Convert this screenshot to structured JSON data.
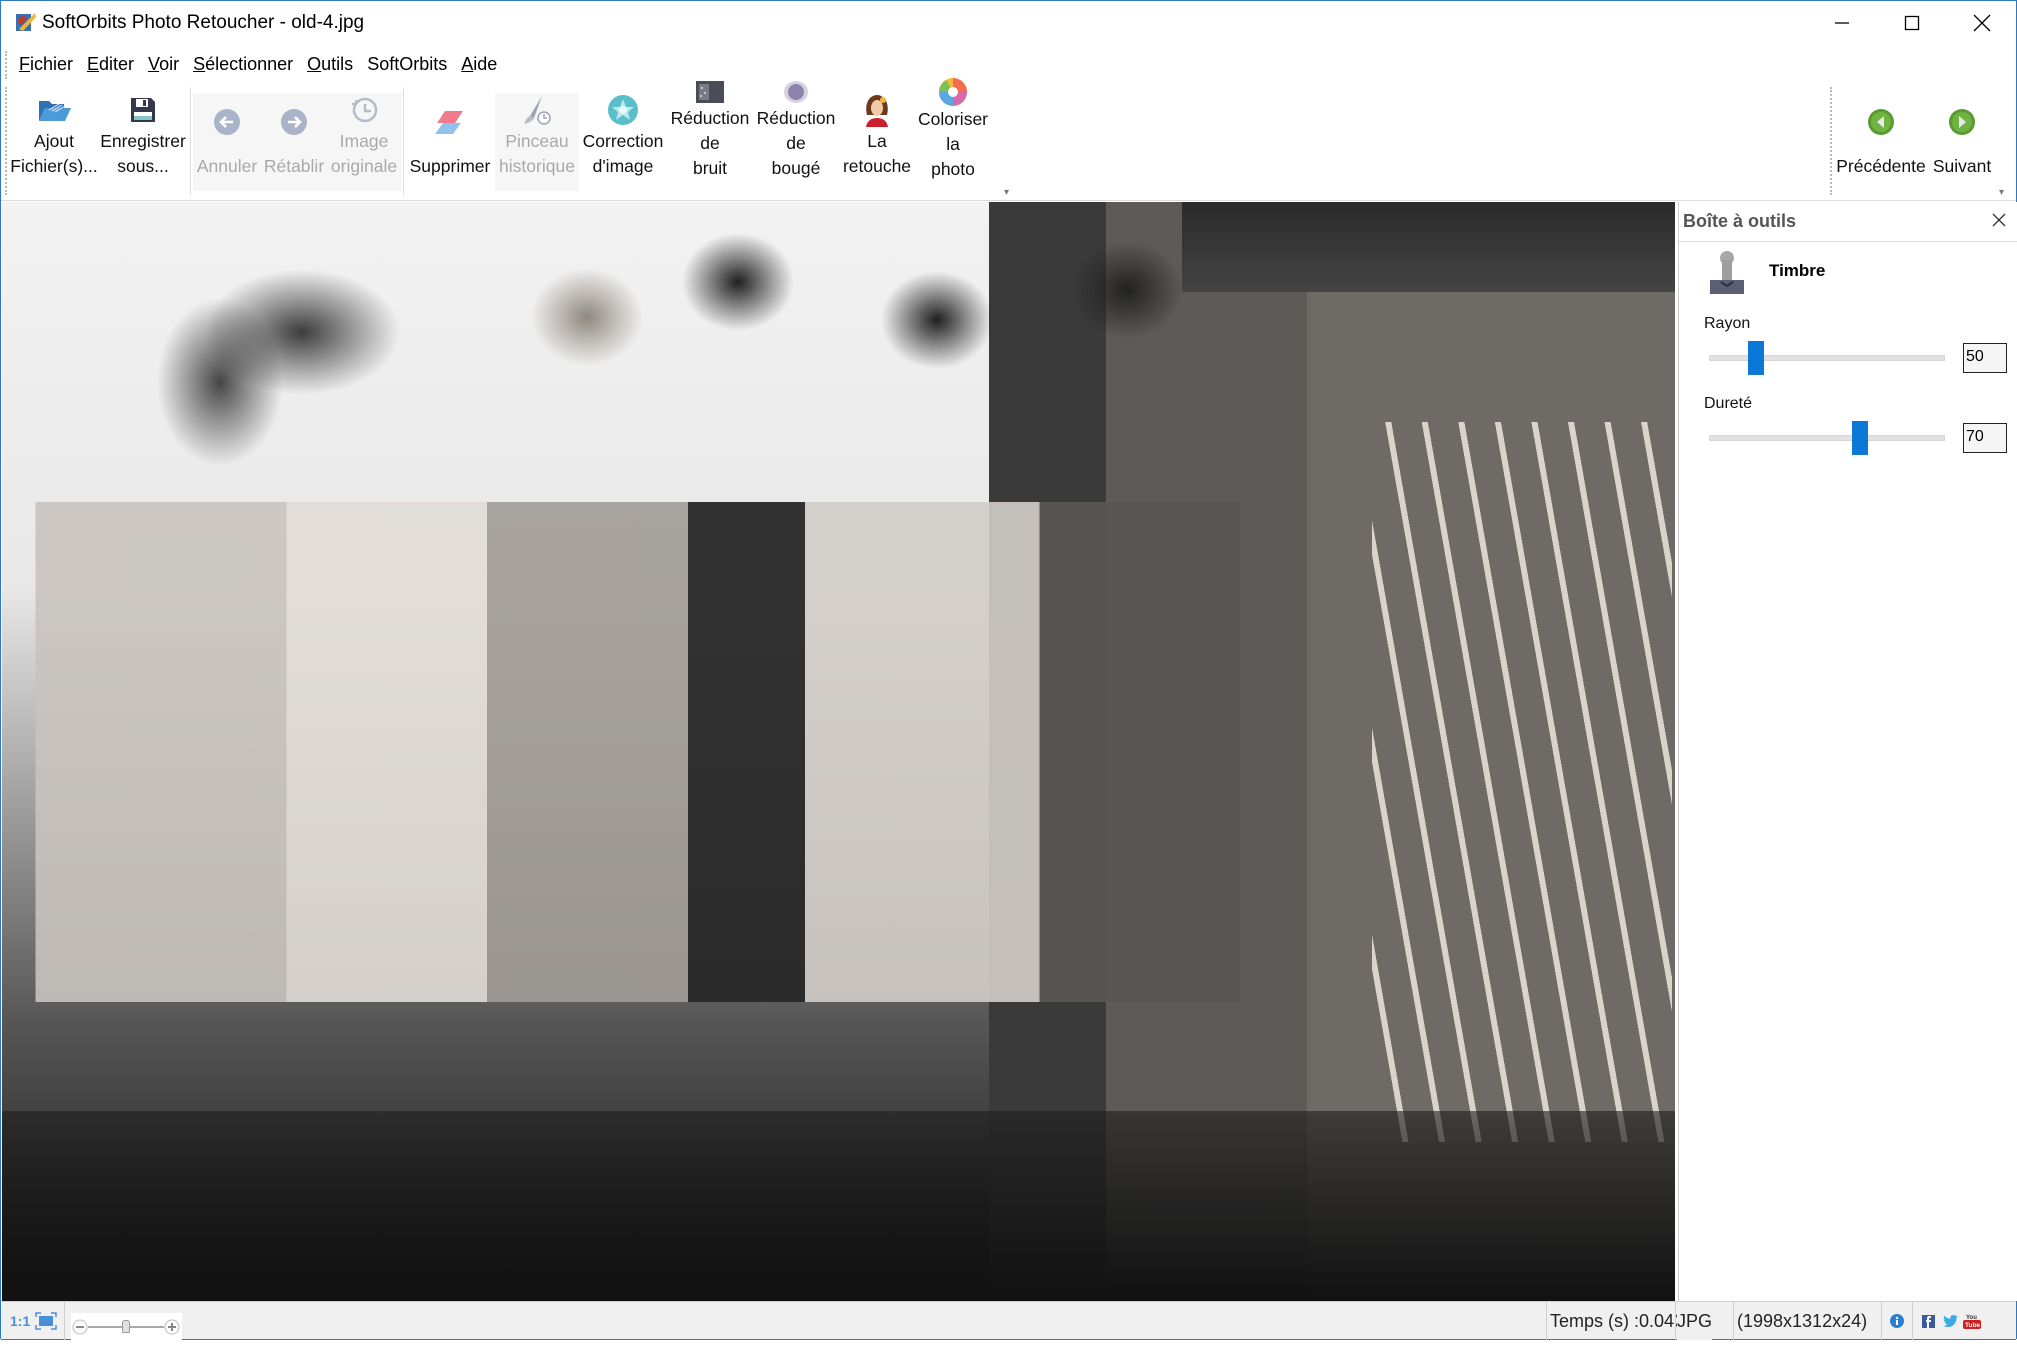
{
  "window": {
    "title": "SoftOrbits Photo Retoucher - old-4.jpg",
    "controls": {
      "minimize": "minimize",
      "maximize": "maximize",
      "close": "close"
    }
  },
  "menu": [
    {
      "label": "Fichier",
      "accel": "F"
    },
    {
      "label": "Editer",
      "accel": "E"
    },
    {
      "label": "Voir",
      "accel": "V"
    },
    {
      "label": "Sélectionner",
      "accel": "S"
    },
    {
      "label": "Outils",
      "accel": "O"
    },
    {
      "label": "SoftOrbits",
      "accel": ""
    },
    {
      "label": "Aide",
      "accel": "A"
    }
  ],
  "toolbar": {
    "add_files": {
      "label": "Ajout\nFichier(s)...",
      "icon": "folder-open-icon",
      "enabled": true
    },
    "save_as": {
      "label": "Enregistrer\nsous...",
      "icon": "floppy-disk-icon",
      "enabled": true
    },
    "undo": {
      "label": "Annuler",
      "icon": "undo-arrow-icon",
      "enabled": false
    },
    "redo": {
      "label": "Rétablir",
      "icon": "redo-arrow-icon",
      "enabled": false
    },
    "original": {
      "label": "Image\noriginale",
      "icon": "history-clock-icon",
      "enabled": false
    },
    "delete": {
      "label": "Supprimer",
      "icon": "eraser-icon",
      "enabled": true
    },
    "history_brush": {
      "label": "Pinceau\nhistorique",
      "icon": "history-brush-icon",
      "enabled": false
    },
    "correction": {
      "label": "Correction\nd'image",
      "icon": "image-correction-icon",
      "enabled": true
    },
    "noise": {
      "label": "Réduction\nde\nbruit",
      "icon": "noise-reduction-icon",
      "enabled": true
    },
    "blur": {
      "label": "Réduction\nde\nbougé",
      "icon": "blur-reduction-icon",
      "enabled": true
    },
    "retouch": {
      "label": "La\nretouche",
      "icon": "retouch-face-icon",
      "enabled": true
    },
    "colorize": {
      "label": "Coloriser\nla\nphoto",
      "icon": "color-wheel-icon",
      "enabled": true
    },
    "previous": {
      "label": "Précédente",
      "icon": "previous-arrow-icon",
      "enabled": true
    },
    "next": {
      "label": "Suivant",
      "icon": "next-arrow-icon",
      "enabled": true
    }
  },
  "toolbox": {
    "title": "Boîte à outils",
    "tool_name": "Timbre",
    "radius": {
      "label": "Rayon",
      "value": "50",
      "slider_fraction": 0.2
    },
    "hardness": {
      "label": "Dureté",
      "value": "70",
      "slider_fraction": 0.64
    }
  },
  "statusbar": {
    "zoom_1to1": "1:1",
    "time": "Temps (s) :0.043",
    "format": "JPG",
    "dimensions": "(1998x1312x24)",
    "zoom_fraction": 0.5
  },
  "colors": {
    "accent": "#0a78d7",
    "window_border": "#2b79c2",
    "disabled_text": "#a9a9a9",
    "nav_green": "#5a9a32"
  }
}
